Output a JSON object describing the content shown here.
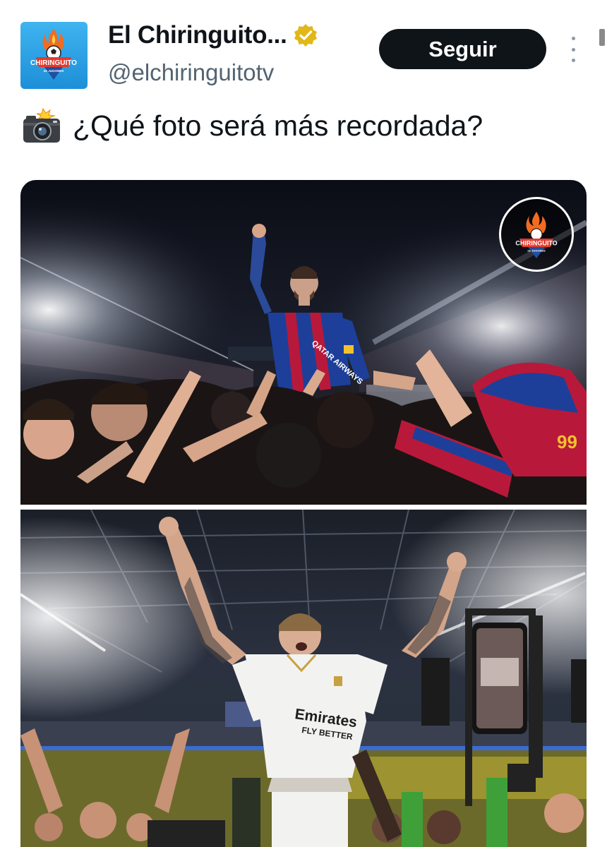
{
  "account": {
    "display_name": "El Chiringuito...",
    "handle": "@elchiringuitotv",
    "avatar_text": "CHIRINGUITO",
    "avatar_subtext": "de JUGONES",
    "verified": true
  },
  "actions": {
    "follow_label": "Seguir"
  },
  "post": {
    "emoji": "camera-with-flash-icon",
    "text": "¿Qué foto será más recordada?"
  },
  "media": {
    "photo_1": {
      "jersey_text": "QATAR AIRWAYS",
      "watermark_text": "CHIRINGUITO",
      "watermark_subtext": "de JUGONES"
    },
    "photo_2": {
      "jersey_text_1": "Emirates",
      "jersey_text_2": "FLY BETTER"
    }
  },
  "colors": {
    "text_primary": "#0f1419",
    "text_secondary": "#536471",
    "follow_bg": "#0f1419",
    "verified_gold": "#e2b719",
    "avatar_bg": "#2a9de6"
  }
}
